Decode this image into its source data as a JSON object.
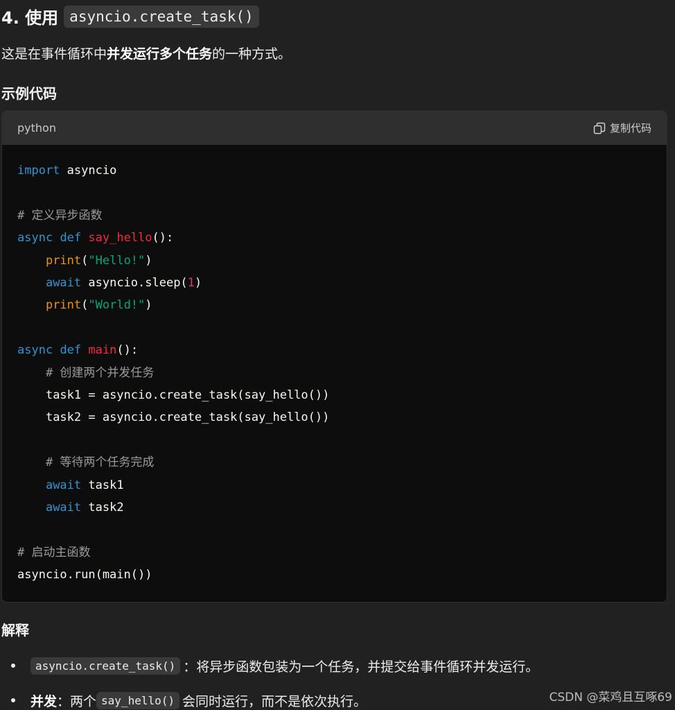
{
  "heading": {
    "number": "4. 使用",
    "code": "asyncio.create_task()"
  },
  "intro": {
    "before": "这是在事件循环中",
    "bold": "并发运行多个任务",
    "after": "的一种方式。"
  },
  "example_heading": "示例代码",
  "code_block": {
    "language": "python",
    "copy_label": "复制代码",
    "copy_icon": "copy-icon",
    "lines": {
      "l1_kw": "import",
      "l1_rest": " asyncio",
      "l3_comment": "# 定义异步函数",
      "l4_async": "async",
      "l4_def": "def",
      "l4_name": "say_hello",
      "l4_rest": "():",
      "l5_print": "print",
      "l5_open": "(",
      "l5_str": "\"Hello!\"",
      "l5_close": ")",
      "l6_await": "await",
      "l6_rest": " asyncio.sleep(",
      "l6_num": "1",
      "l6_close": ")",
      "l7_print": "print",
      "l7_open": "(",
      "l7_str": "\"World!\"",
      "l7_close": ")",
      "l9_async": "async",
      "l9_def": "def",
      "l9_name": "main",
      "l9_rest": "():",
      "l10_comment": "# 创建两个并发任务",
      "l11": "task1 = asyncio.create_task(say_hello())",
      "l12": "task2 = asyncio.create_task(say_hello())",
      "l14_comment": "# 等待两个任务完成",
      "l15_await": "await",
      "l15_rest": " task1",
      "l16_await": "await",
      "l16_rest": " task2",
      "l18_comment": "# 启动主函数",
      "l19": "asyncio.run(main())"
    }
  },
  "explanation_heading": "解释",
  "bullets": [
    {
      "code": "asyncio.create_task()",
      "text": "：将异步函数包装为一个任务，并提交给事件循环并发运行。"
    },
    {
      "bold": "并发",
      "text_before": "：两个 ",
      "code": "say_hello()",
      "text_after": " 会同时运行，而不是依次执行。"
    }
  ],
  "watermark": "CSDN @菜鸡且互啄69",
  "colors": {
    "background": "#212121",
    "code_background": "#0d0d0d",
    "keyword": "#2e95d3",
    "function_name": "#f22c3d",
    "builtin": "#e9950c",
    "string": "#00a67d",
    "number": "#df3079",
    "comment": "#9a9a9a"
  }
}
